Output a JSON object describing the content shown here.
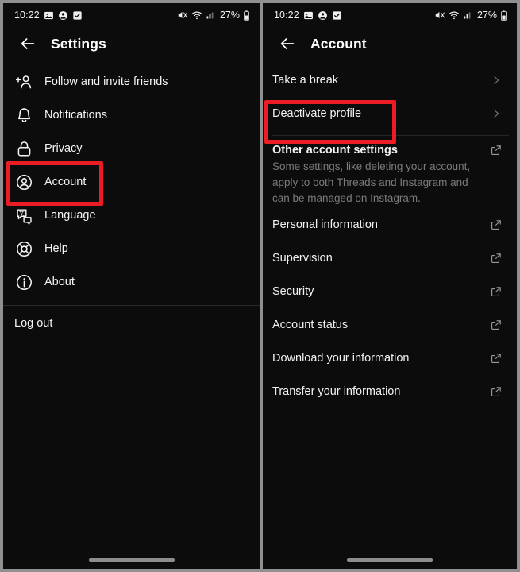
{
  "status_bar": {
    "time": "10:22",
    "battery_percent": "27%",
    "left_icons": [
      "image-icon",
      "person-badge-icon",
      "checkbox-icon"
    ],
    "right_icons": [
      "mute-icon",
      "wifi-icon",
      "cell-signal-icon",
      "battery-icon"
    ]
  },
  "left_panel": {
    "header": {
      "title": "Settings",
      "back_icon": "back-arrow-icon"
    },
    "items": [
      {
        "label": "Follow and invite friends",
        "icon": "person-add-icon"
      },
      {
        "label": "Notifications",
        "icon": "bell-icon"
      },
      {
        "label": "Privacy",
        "icon": "lock-icon"
      },
      {
        "label": "Account",
        "icon": "account-circle-icon",
        "highlighted": true
      },
      {
        "label": "Language",
        "icon": "translate-icon"
      },
      {
        "label": "Help",
        "icon": "lifebuoy-icon"
      },
      {
        "label": "About",
        "icon": "info-circle-icon"
      }
    ],
    "logout_label": "Log out"
  },
  "right_panel": {
    "header": {
      "title": "Account",
      "back_icon": "back-arrow-icon"
    },
    "top_rows": [
      {
        "label": "Take a break",
        "trailing": "chevron-right-icon"
      },
      {
        "label": "Deactivate profile",
        "trailing": "chevron-right-icon",
        "highlighted": true
      }
    ],
    "section": {
      "title": "Other account settings",
      "trailing": "external-link-icon",
      "description": "Some settings, like deleting your account, apply to both Threads and Instagram and can be managed on Instagram."
    },
    "rows": [
      {
        "label": "Personal information",
        "trailing": "external-link-icon"
      },
      {
        "label": "Supervision",
        "trailing": "external-link-icon"
      },
      {
        "label": "Security",
        "trailing": "external-link-icon"
      },
      {
        "label": "Account status",
        "trailing": "external-link-icon"
      },
      {
        "label": "Download your information",
        "trailing": "external-link-icon"
      },
      {
        "label": "Transfer your information",
        "trailing": "external-link-icon"
      }
    ]
  },
  "annotations": {
    "color": "#ec1c24",
    "boxes": [
      "account-menu-item",
      "deactivate-profile-row"
    ]
  },
  "gesture_bar": "home-indicator"
}
